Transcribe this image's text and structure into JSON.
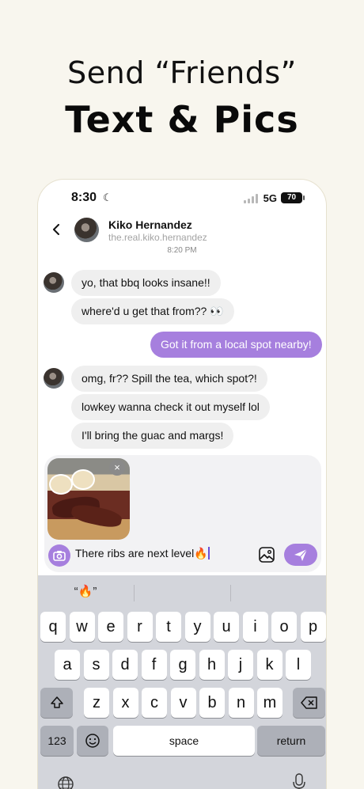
{
  "headline": {
    "line1": "Send “Friends”",
    "line2": "Text & Pics"
  },
  "status_bar": {
    "time": "8:30",
    "network": "5G",
    "battery": "70"
  },
  "header": {
    "name": "Kiko Hernandez",
    "handle": "the.real.kiko.hernandez",
    "timestamp": "8:20 PM"
  },
  "messages": [
    {
      "text": "yo, that bbq looks insane!!",
      "direction": "incoming"
    },
    {
      "text": "where'd u get that from?? 👀",
      "direction": "incoming"
    },
    {
      "text": "Got it from a local spot nearby!",
      "direction": "outgoing"
    },
    {
      "text": "omg, fr??  Spill the tea, which spot?!",
      "direction": "incoming"
    },
    {
      "text": "lowkey wanna check it out myself lol",
      "direction": "incoming"
    },
    {
      "text": "I'll bring the guac and margs!",
      "direction": "incoming"
    }
  ],
  "compose": {
    "attachment": "bbq-platter-photo",
    "remove_label": "×",
    "text": "There ribs are next level🔥"
  },
  "keyboard": {
    "suggestions": [
      "“🔥”",
      "",
      ""
    ],
    "row1": [
      "q",
      "w",
      "e",
      "r",
      "t",
      "y",
      "u",
      "i",
      "o",
      "p"
    ],
    "row2": [
      "a",
      "s",
      "d",
      "f",
      "g",
      "h",
      "j",
      "k",
      "l"
    ],
    "row3": [
      "z",
      "x",
      "c",
      "v",
      "b",
      "n",
      "m"
    ],
    "numbers_label": "123",
    "space_label": "space",
    "return_label": "return"
  },
  "colors": {
    "accent": "#a67fde",
    "background": "#f8f6ee",
    "incoming_bubble": "#efefef",
    "keyboard": "#d3d5db"
  }
}
